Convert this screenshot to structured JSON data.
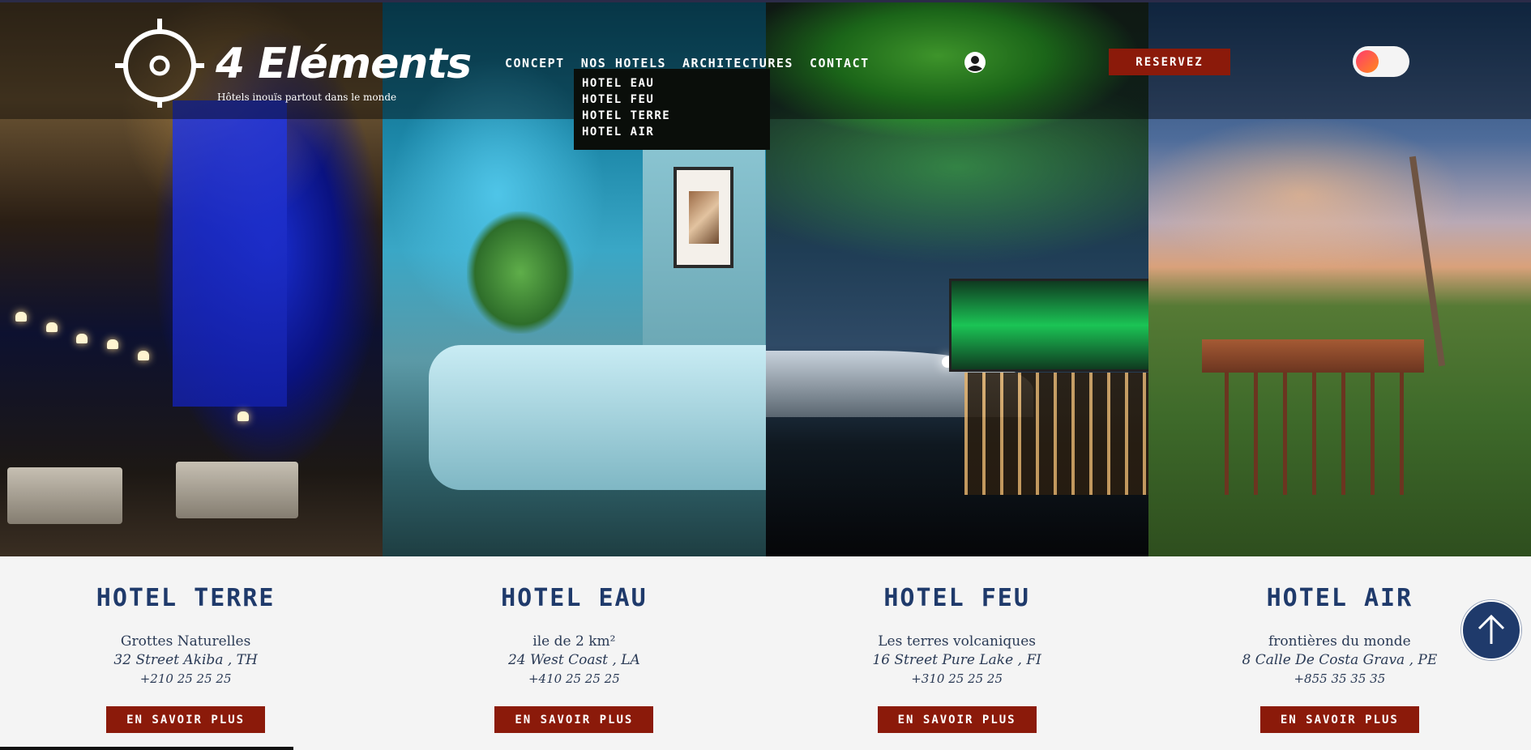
{
  "brand": {
    "name": "4 Eléments",
    "tagline": "Hôtels inouïs partout dans le monde"
  },
  "nav": {
    "items": [
      "CONCEPT",
      "NOS HOTELS",
      "ARCHITECTURES",
      "CONTACT"
    ],
    "dropdown": [
      "HOTEL EAU",
      "HOTEL FEU",
      "HOTEL TERRE",
      "HOTEL AIR"
    ]
  },
  "header": {
    "reserve_label": "RESERVEZ",
    "account_icon": "account-circle-icon",
    "toggle_state": "off"
  },
  "hotels": [
    {
      "title": "HOTEL TERRE",
      "description": "Grottes Naturelles",
      "address": "32 Street Akiba , TH",
      "phone": "+210 25 25 25",
      "button": "EN SAVOIR PLUS"
    },
    {
      "title": "HOTEL EAU",
      "description": "ile de 2 km²",
      "address": "24 West Coast , LA",
      "phone": "+410 25 25 25",
      "button": "EN SAVOIR PLUS"
    },
    {
      "title": "HOTEL FEU",
      "description": "Les terres volcaniques",
      "address": "16 Street Pure Lake , FI",
      "phone": "+310 25 25 25",
      "button": "EN SAVOIR PLUS"
    },
    {
      "title": "HOTEL AIR",
      "description": "frontières du monde",
      "address": "8 Calle De Costa Grava , PE",
      "phone": "+855 35 35 35",
      "button": "EN SAVOIR PLUS"
    }
  ],
  "colors": {
    "accent_red": "#8b1a0a",
    "title_blue": "#1f3a6b",
    "background": "#f4f4f4"
  },
  "scroll_top_icon": "arrow-up-icon"
}
